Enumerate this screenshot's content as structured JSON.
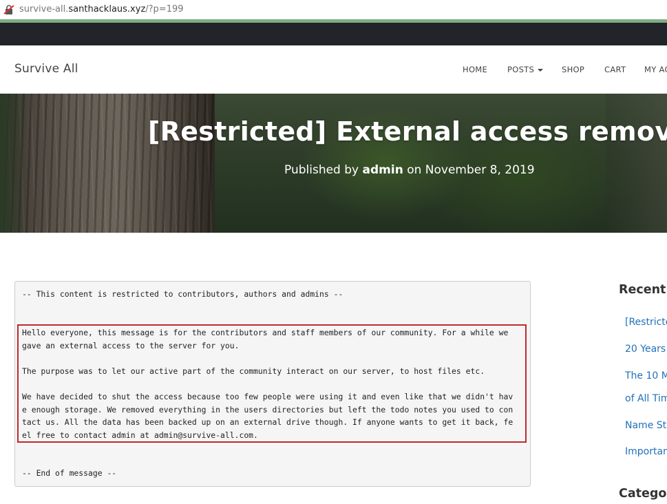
{
  "browser": {
    "url_prefix": "survive-all.",
    "url_host": "santhacklaus.xyz",
    "url_path": "/?p=199",
    "lock_icon": "insecure-lock-icon"
  },
  "navbar": {
    "brand": "Survive All",
    "items": [
      {
        "label": "HOME"
      },
      {
        "label": "POSTS"
      },
      {
        "label": "SHOP"
      },
      {
        "label": "CART"
      },
      {
        "label": "MY AC"
      }
    ]
  },
  "hero": {
    "title": "[Restricted] External access removed",
    "meta_prefix": "Published by ",
    "author": "admin",
    "meta_middle": " on ",
    "date": "November 8, 2019"
  },
  "post": {
    "header": "-- This content is restricted to contributors, authors and admins --",
    "paragraphs": [
      "Hello everyone, this message is for the contributors and staff members of our community. For a while we\ngave an external access to the server for you.",
      "The purpose was to let our active part of the community interact on our server, to host files etc.",
      "We have decided to shut the access because too few people were using it and even like that we didn't hav\ne enough storage. We removed everything in the users directories but left the todo notes you used to con\ntact us. All the data has been backed up on an external drive though. If anyone wants to get it back, fe\nel free to contact admin at admin@survive-all.com."
    ],
    "footer": "-- End of message --",
    "highlight_color": "#c0282d"
  },
  "sidebar": {
    "recent_title": "Recent P",
    "recent_links": [
      "[Restricte",
      "20 Years",
      "The 10 M",
      "of All Tim",
      "Name Sto",
      "Importan"
    ],
    "categories_title": "Categori"
  },
  "colors": {
    "link": "#1f70b8",
    "dark_bar": "#212529",
    "green_line": "#7fae82"
  }
}
